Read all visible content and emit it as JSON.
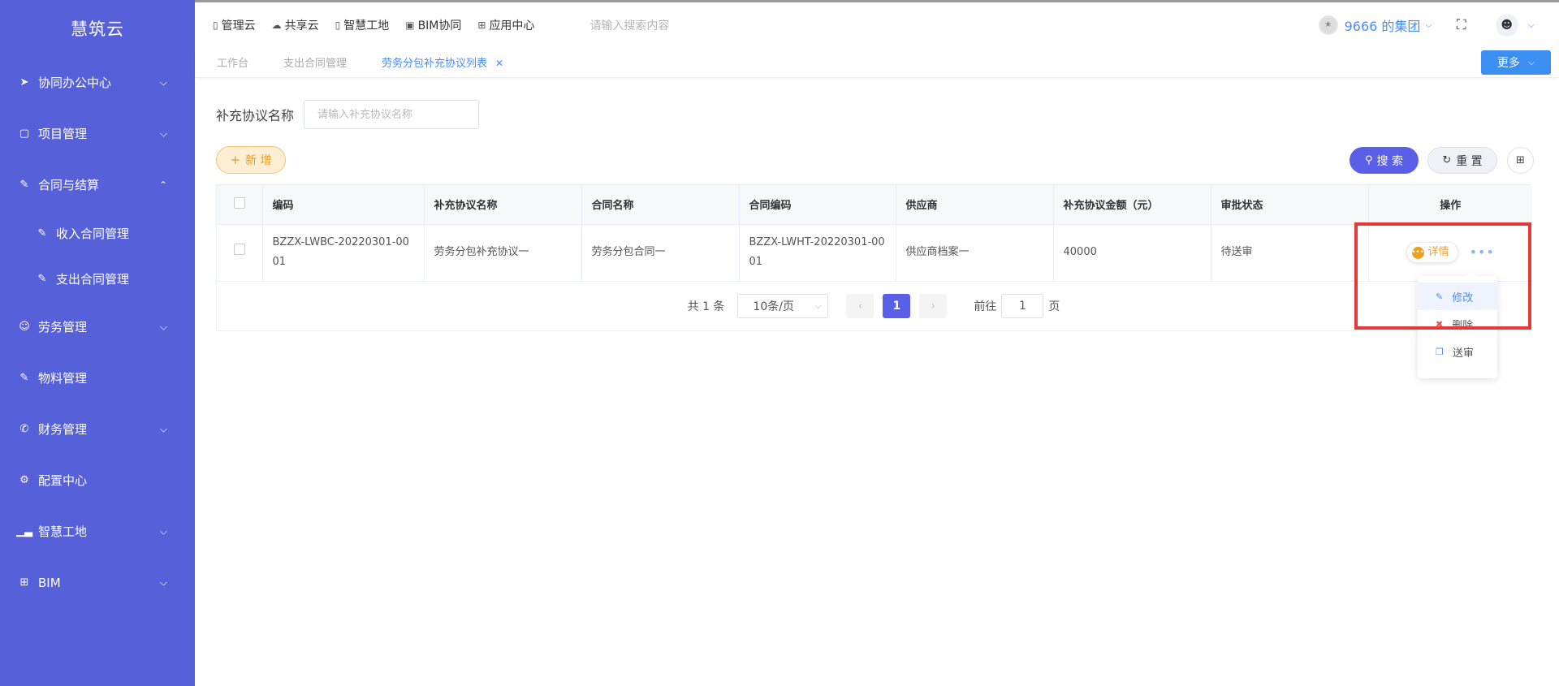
{
  "brand": "慧筑云",
  "sidebar": {
    "items": [
      {
        "label": "协同办公中心",
        "icon": "send-icon",
        "expanded": false
      },
      {
        "label": "项目管理",
        "icon": "book-icon",
        "expanded": false
      },
      {
        "label": "合同与结算",
        "icon": "edit-doc-icon",
        "expanded": true
      },
      {
        "label": "劳务管理",
        "icon": "user-icon",
        "expanded": false
      },
      {
        "label": "物料管理",
        "icon": "edit-doc-icon"
      },
      {
        "label": "财务管理",
        "icon": "phone-icon",
        "expanded": false
      },
      {
        "label": "配置中心",
        "icon": "gear-icon"
      },
      {
        "label": "智慧工地",
        "icon": "bar-chart-icon",
        "expanded": false
      },
      {
        "label": "BIM",
        "icon": "grid-icon",
        "expanded": false
      }
    ],
    "sub_items": [
      {
        "label": "收入合同管理"
      },
      {
        "label": "支出合同管理"
      }
    ]
  },
  "topbar": {
    "nav": [
      {
        "label": "管理云",
        "icon": "panel-icon"
      },
      {
        "label": "共享云",
        "icon": "cloud-icon"
      },
      {
        "label": "智慧工地",
        "icon": "doc-icon"
      },
      {
        "label": "BIM协同",
        "icon": "cube-icon"
      },
      {
        "label": "应用中心",
        "icon": "apps-icon"
      }
    ],
    "search_placeholder": "请输入搜索内容",
    "org_name": "9666 的集团"
  },
  "tabs": [
    {
      "label": "工作台",
      "active": false
    },
    {
      "label": "支出合同管理",
      "active": false
    },
    {
      "label": "劳务分包补充协议列表",
      "active": true
    }
  ],
  "more_label": "更多",
  "filter": {
    "label": "补充协议名称",
    "placeholder": "请输入补充协议名称"
  },
  "toolbar": {
    "add_label": "新 增",
    "search_label": "搜 索",
    "reset_label": "重 置"
  },
  "table": {
    "headers": [
      "编码",
      "补充协议名称",
      "合同名称",
      "合同编码",
      "供应商",
      "补充协议金额（元）",
      "审批状态",
      "操作"
    ],
    "rows": [
      {
        "code": "BZZX-LWBC-20220301-0001",
        "agreement_name": "劳务分包补充协议一",
        "contract_name": "劳务分包合同一",
        "contract_code": "BZZX-LWHT-20220301-0001",
        "supplier": "供应商档案一",
        "amount": "40000",
        "status": "待送审"
      }
    ],
    "detail_label": "详情"
  },
  "pagination": {
    "total": "共 1 条",
    "page_size": "10条/页",
    "current_page": "1",
    "goto_label": "前往",
    "goto_value": "1",
    "unit": "页"
  },
  "dropdown": {
    "items": [
      "修改",
      "删除",
      "送审"
    ]
  },
  "colors": {
    "sidebar_bg": "#5660d8",
    "primary": "#5a5fe8",
    "link": "#4a8cf6",
    "highlight": "#e53935",
    "add_accent": "#e89b1e"
  }
}
